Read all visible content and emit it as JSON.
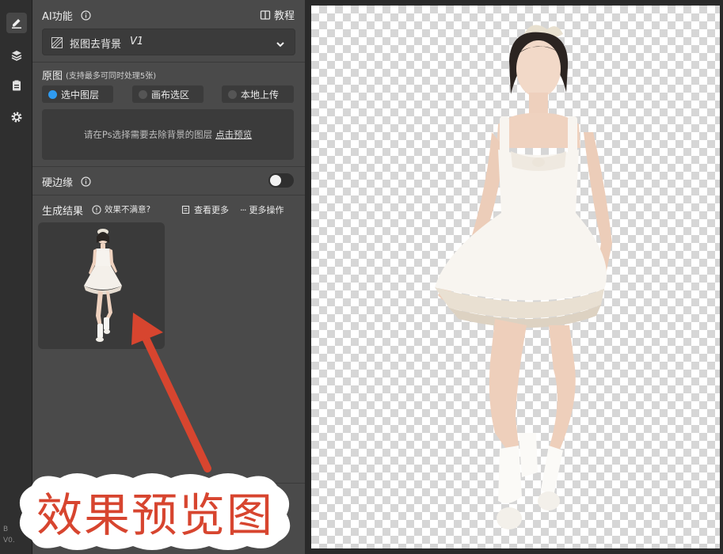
{
  "sidebar": {
    "version_letter": "B",
    "version_text": "V0."
  },
  "ai": {
    "section_title": "AI功能",
    "tutorial_label": "教程",
    "selected_function": "抠图去背景",
    "selected_version": "V1"
  },
  "source": {
    "title": "原图",
    "hint": "(支持最多可同时处理5张)",
    "options": [
      "选中图层",
      "画布选区",
      "本地上传"
    ],
    "selected_option": "选中图层",
    "dropzone_text": "请在Ps选择需要去除背景的图层",
    "dropzone_link": "点击预览"
  },
  "hard_edge": {
    "label": "硬边缘",
    "enabled": false
  },
  "result": {
    "title": "生成结果",
    "feedback_label": "效果不满意?",
    "view_more_label": "查看更多",
    "more_actions_label": "更多操作"
  },
  "annotation": {
    "caption": "效果预览图",
    "color": "#d7452f"
  },
  "colors": {
    "accent": "#2f9bf0",
    "panel": "#4a4a4a",
    "rail": "#2f2f2f"
  }
}
